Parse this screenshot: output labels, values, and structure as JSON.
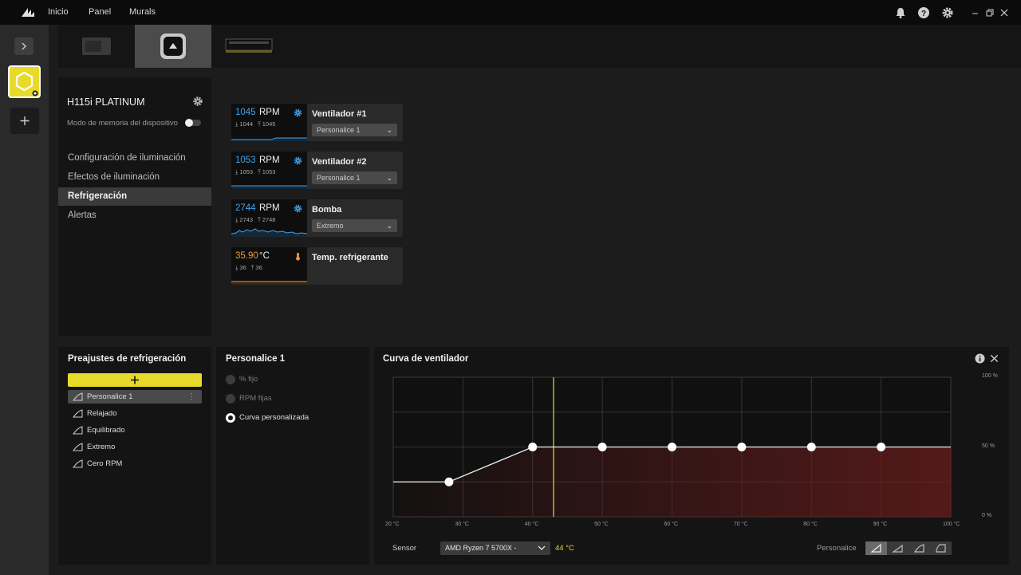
{
  "nav": {
    "home": "Inicio",
    "dashboard": "Panel",
    "murals": "Murals"
  },
  "device": {
    "name": "H115i PLATINUM",
    "memory_mode_label": "Modo de memoria del dispositivo",
    "memory_mode_on": false
  },
  "menu": [
    {
      "label": "Configuración de iluminación",
      "active": false
    },
    {
      "label": "Efectos de iluminación",
      "active": false
    },
    {
      "label": "Refrigeración",
      "active": true
    },
    {
      "label": "Alertas",
      "active": false
    }
  ],
  "cards": [
    {
      "value": "1045",
      "unit": "RPM",
      "min": "1044",
      "max": "1045",
      "name": "Ventilador #1",
      "select": "Personalice 1",
      "icon": "fan-icon",
      "color": "#3fa3f0"
    },
    {
      "value": "1053",
      "unit": "RPM",
      "min": "1053",
      "max": "1053",
      "name": "Ventilador #2",
      "select": "Personalice 1",
      "icon": "fan-icon",
      "color": "#3fa3f0"
    },
    {
      "value": "2744",
      "unit": "RPM",
      "min": "2743",
      "max": "2748",
      "name": "Bomba",
      "select": "Extremo",
      "icon": "pump-icon",
      "color": "#3fa3f0"
    },
    {
      "value": "35.90",
      "unit": "°C",
      "min": "36",
      "max": "36",
      "name": "Temp. refrigerante",
      "select": "",
      "icon": "thermometer-icon",
      "color": "#f09a3e"
    }
  ],
  "presets": {
    "title": "Preajustes de refrigeración",
    "items": [
      {
        "label": "Personalice 1",
        "selected": true
      },
      {
        "label": "Relajado",
        "selected": false
      },
      {
        "label": "Equilibrado",
        "selected": false
      },
      {
        "label": "Extremo",
        "selected": false
      },
      {
        "label": "Cero RPM",
        "selected": false
      }
    ]
  },
  "mode": {
    "title": "Personalice 1",
    "options": [
      {
        "label": "% fijo",
        "selected": false
      },
      {
        "label": "RPM fijas",
        "selected": false
      },
      {
        "label": "Curva personalizada",
        "selected": true
      }
    ]
  },
  "curve": {
    "title": "Curva de ventilador",
    "sensor_label": "Sensor",
    "sensor_value": "AMD Ryzen 7 5700X -",
    "sensor_temp": "44 °C",
    "current_temp": 43,
    "preset_label": "Personalice",
    "x_ticks": [
      "20 °C",
      "30 °C",
      "40 °C",
      "50 °C",
      "60 °C",
      "70 °C",
      "80 °C",
      "90 °C",
      "100 °C"
    ],
    "y_ticks": [
      "100 %",
      "50 %",
      "0 %"
    ],
    "points": [
      {
        "temp": 28,
        "percent": 25
      },
      {
        "temp": 40,
        "percent": 50
      },
      {
        "temp": 50,
        "percent": 50
      },
      {
        "temp": 60,
        "percent": 50
      },
      {
        "temp": 70,
        "percent": 50
      },
      {
        "temp": 80,
        "percent": 50
      },
      {
        "temp": 90,
        "percent": 50
      }
    ],
    "x_range": [
      20,
      100
    ],
    "y_range": [
      0,
      100
    ]
  },
  "colors": {
    "accent": "#e8da2a",
    "rpm": "#3fa3f0",
    "temp": "#f09a3e",
    "curve_fill": "#6b1d1d"
  }
}
